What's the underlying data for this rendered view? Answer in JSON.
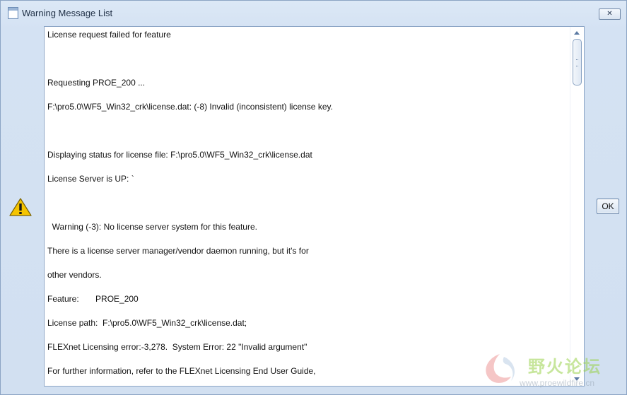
{
  "window": {
    "title": "Warning Message List",
    "close_label": "✕"
  },
  "messages": [
    "License request failed for feature",
    "",
    "Requesting PROE_200 ...",
    "F:\\pro5.0\\WF5_Win32_crk\\license.dat: (-8) Invalid (inconsistent) license key.",
    "",
    "Displaying status for license file: F:\\pro5.0\\WF5_Win32_crk\\license.dat",
    "License Server is UP: `",
    "",
    "  Warning (-3): No license server system for this feature.",
    "There is a license server manager/vendor daemon running, but it's for",
    "other vendors.",
    "Feature:       PROE_200",
    "License path:  F:\\pro5.0\\WF5_Win32_crk\\license.dat;",
    "FLEXnet Licensing error:-3,278.  System Error: 22 \"Invalid argument\"",
    "For further information, refer to the FLEXnet Licensing End User Guide,"
  ],
  "buttons": {
    "ok_label": "OK"
  },
  "icons": {
    "window_icon": "window-icon",
    "warning": "warning-icon",
    "scroll_up": "scroll-up-icon",
    "scroll_down": "scroll-down-icon"
  },
  "watermark": {
    "text": "野火论坛",
    "url": "www.proewildfire.cn"
  },
  "colors": {
    "window_bg": "#d6e3f2",
    "warning_yellow": "#f5c400",
    "watermark_green": "#9bd24d"
  }
}
